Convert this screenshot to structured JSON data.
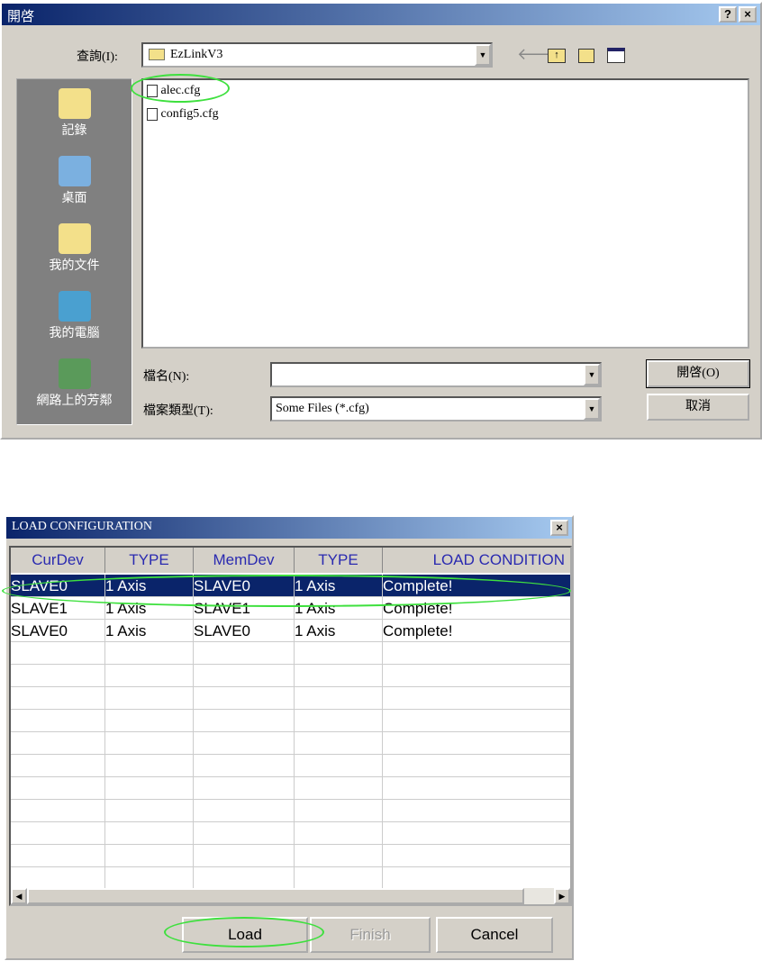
{
  "open_dialog": {
    "title": "開啓",
    "help": "?",
    "close": "×",
    "look_in_label": "查詢(I):",
    "look_in_value": "EzLinkV3",
    "places": [
      {
        "label": "記錄",
        "icon": "history-icon"
      },
      {
        "label": "桌面",
        "icon": "desktop-icon"
      },
      {
        "label": "我的文件",
        "icon": "my-documents-icon"
      },
      {
        "label": "我的電腦",
        "icon": "my-computer-icon"
      },
      {
        "label": "網路上的芳鄰",
        "icon": "network-icon"
      }
    ],
    "files": [
      "alec.cfg",
      "config5.cfg"
    ],
    "filename_label": "檔名(N):",
    "filename_value": "",
    "filetype_label": "檔案類型(T):",
    "filetype_value": "Some Files (*.cfg)",
    "open_button": "開啓(O)",
    "cancel_button": "取消"
  },
  "load_dialog": {
    "title": "LOAD CONFIGURATION",
    "close": "×",
    "columns": [
      "CurDev",
      "TYPE",
      "MemDev",
      "TYPE",
      "LOAD CONDITION"
    ],
    "rows": [
      [
        "SLAVE0",
        "1 Axis",
        "SLAVE0",
        "1 Axis",
        "Complete!"
      ],
      [
        "SLAVE1",
        "1 Axis",
        "SLAVE1",
        "1 Axis",
        "Complete!"
      ],
      [
        "SLAVE0",
        "1 Axis",
        "SLAVE0",
        "1 Axis",
        "Complete!"
      ]
    ],
    "selected_row": 0,
    "load_button": "Load",
    "finish_button": "Finish",
    "cancel_button": "Cancel"
  },
  "colors": {
    "titlebar": "#0a246a",
    "highlight": "#3ee03e",
    "header_text": "#2a2ab0"
  }
}
